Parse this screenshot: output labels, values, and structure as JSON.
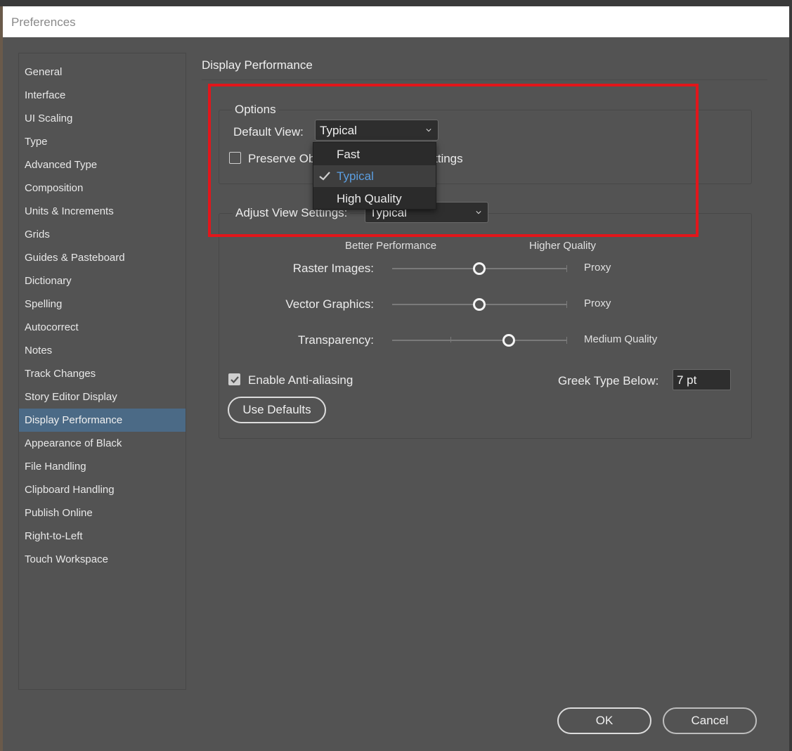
{
  "window": {
    "title": "Preferences"
  },
  "sidebar": {
    "items": [
      {
        "label": "General"
      },
      {
        "label": "Interface"
      },
      {
        "label": "UI Scaling"
      },
      {
        "label": "Type"
      },
      {
        "label": "Advanced Type"
      },
      {
        "label": "Composition"
      },
      {
        "label": "Units & Increments"
      },
      {
        "label": "Grids"
      },
      {
        "label": "Guides & Pasteboard"
      },
      {
        "label": "Dictionary"
      },
      {
        "label": "Spelling"
      },
      {
        "label": "Autocorrect"
      },
      {
        "label": "Notes"
      },
      {
        "label": "Track Changes"
      },
      {
        "label": "Story Editor Display"
      },
      {
        "label": "Display Performance"
      },
      {
        "label": "Appearance of Black"
      },
      {
        "label": "File Handling"
      },
      {
        "label": "Clipboard Handling"
      },
      {
        "label": "Publish Online"
      },
      {
        "label": "Right-to-Left"
      },
      {
        "label": "Touch Workspace"
      }
    ],
    "active": "Display Performance"
  },
  "main": {
    "section_title": "Display Performance",
    "options": {
      "legend": "Options",
      "default_view_label": "Default View:",
      "default_view_value": "Typical",
      "preserve_label_left": "Preserve Ob",
      "preserve_label_right": "ttings",
      "preserve_checked": false
    },
    "dropdown": {
      "items": [
        "Fast",
        "Typical",
        "High Quality"
      ],
      "selected": "Typical"
    },
    "adjust": {
      "label": "Adjust View Settings:",
      "value": "Typical",
      "better_performance": "Better Performance",
      "higher_quality": "Higher Quality",
      "sliders": [
        {
          "label": "Raster Images:",
          "value_text": "Proxy",
          "level": 0.5
        },
        {
          "label": "Vector Graphics:",
          "value_text": "Proxy",
          "level": 0.5
        },
        {
          "label": "Transparency:",
          "value_text": "Medium Quality",
          "level": 0.67
        }
      ],
      "anti_alias_label": "Enable Anti-aliasing",
      "anti_alias_checked": true,
      "greek_label": "Greek Type Below:",
      "greek_value": "7 pt",
      "use_defaults": "Use Defaults"
    }
  },
  "footer": {
    "ok": "OK",
    "cancel": "Cancel"
  },
  "colors": {
    "accent_selected": "#4b6a86",
    "dropdown_selected_text": "#5b9ee0",
    "highlight_border": "#e2161b"
  }
}
